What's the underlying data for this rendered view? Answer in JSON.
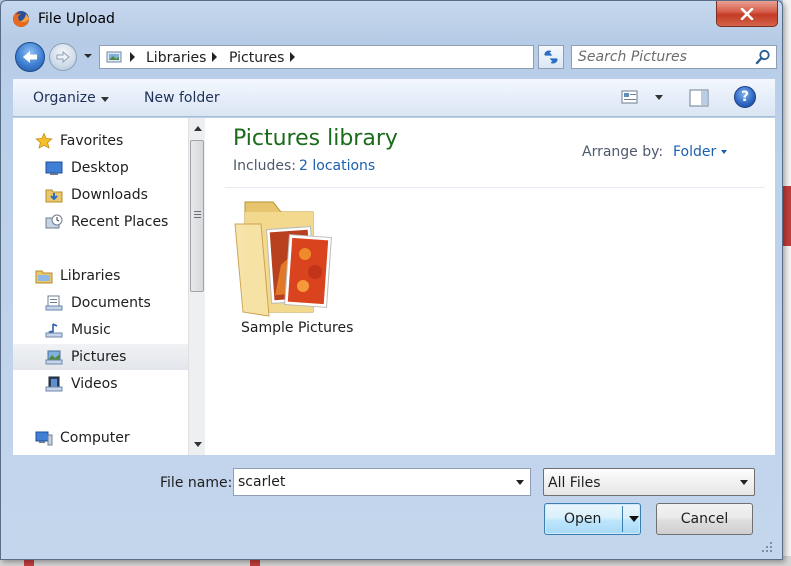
{
  "window": {
    "title": "File Upload",
    "close_glyph": "✕"
  },
  "navigation": {
    "breadcrumb": [
      "Libraries",
      "Pictures"
    ]
  },
  "search": {
    "placeholder": "Search Pictures"
  },
  "toolbar": {
    "organize_label": "Organize",
    "new_folder_label": "New folder",
    "help_glyph": "?"
  },
  "sidebar": {
    "favorites": {
      "label": "Favorites",
      "items": [
        {
          "label": "Desktop",
          "icon": "desktop-icon"
        },
        {
          "label": "Downloads",
          "icon": "downloads-icon"
        },
        {
          "label": "Recent Places",
          "icon": "recent-places-icon"
        }
      ]
    },
    "libraries": {
      "label": "Libraries",
      "items": [
        {
          "label": "Documents",
          "icon": "documents-icon"
        },
        {
          "label": "Music",
          "icon": "music-icon"
        },
        {
          "label": "Pictures",
          "icon": "pictures-icon",
          "selected": true
        },
        {
          "label": "Videos",
          "icon": "videos-icon"
        }
      ]
    },
    "computer": {
      "label": "Computer"
    }
  },
  "library": {
    "title": "Pictures library",
    "includes_label": "Includes:",
    "includes_link": "2 locations",
    "arrange_label": "Arrange by:",
    "arrange_value": "Folder"
  },
  "files": [
    {
      "name": "Sample Pictures",
      "icon": "pictures-folder-icon"
    }
  ],
  "footer": {
    "file_name_label": "File name:",
    "file_name_value": "scarlet",
    "file_type_value": "All Files",
    "open_label": "Open",
    "cancel_label": "Cancel"
  },
  "colors": {
    "library_title": "#1a6b1c",
    "link": "#1b5fb0",
    "close_button": "#c43b25"
  }
}
